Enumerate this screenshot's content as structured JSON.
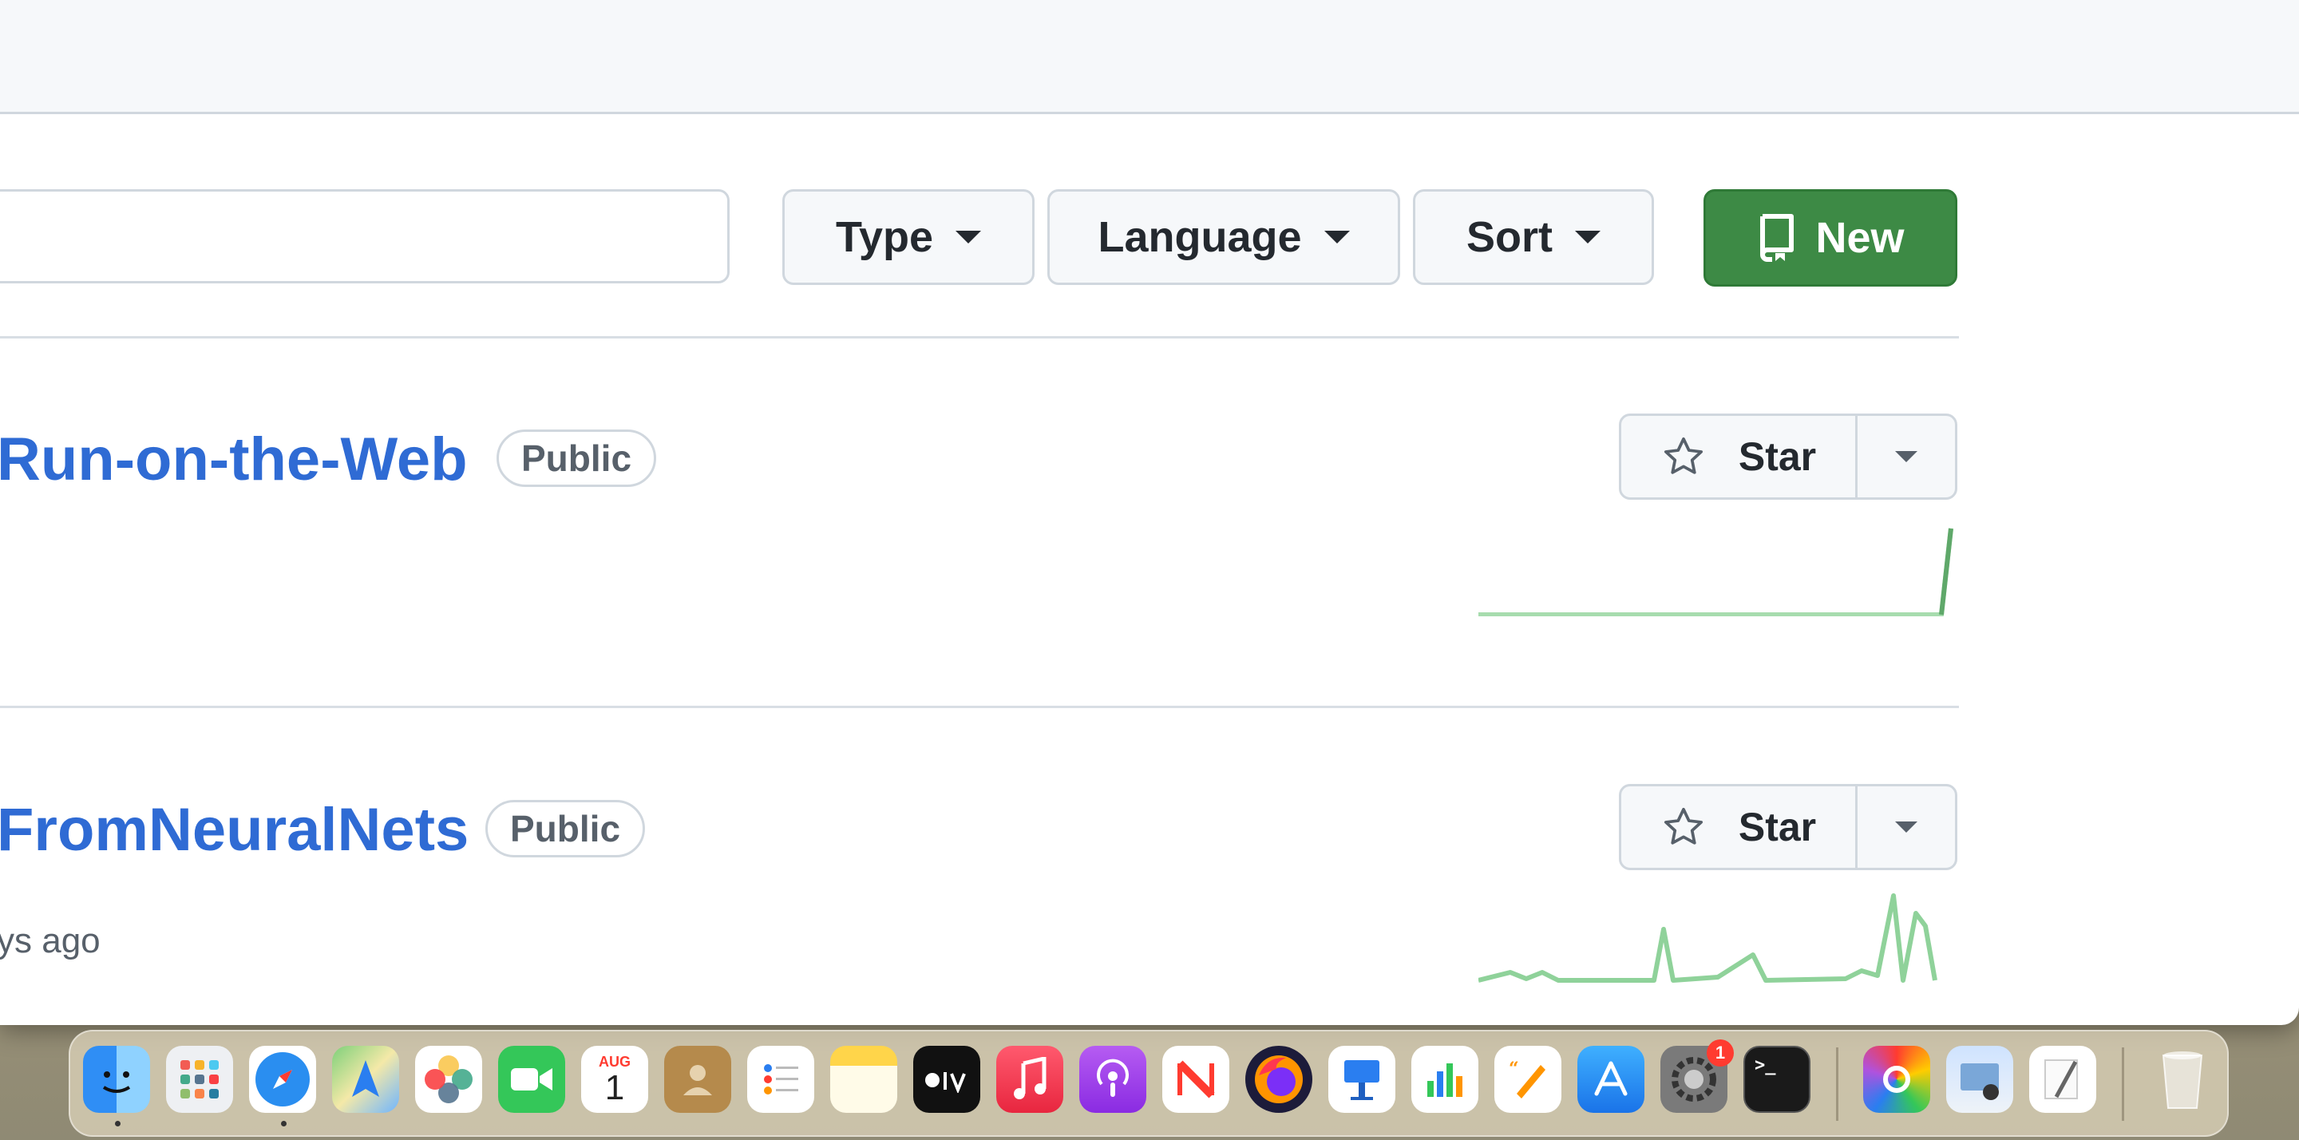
{
  "filters": {
    "type_label": "Type",
    "language_label": "Language",
    "sort_label": "Sort",
    "new_label": "New"
  },
  "repos": [
    {
      "name": "Run-on-the-Web",
      "visibility": "Public",
      "updated": "",
      "star_label": "Star"
    },
    {
      "name": "FromNeuralNets",
      "visibility": "Public",
      "updated": "ys ago",
      "star_label": "Star"
    }
  ],
  "dock": {
    "calendar_month": "AUG",
    "calendar_day": "1",
    "settings_badge": "1",
    "icons": [
      "finder-icon",
      "launchpad-icon",
      "safari-icon",
      "maps-icon",
      "photos-icon",
      "facetime-icon",
      "calendar-icon",
      "contacts-icon",
      "reminders-icon",
      "notes-icon",
      "apple-tv-icon",
      "music-icon",
      "podcasts-icon",
      "news-icon",
      "firefox-icon",
      "keynote-icon",
      "numbers-icon",
      "pages-icon",
      "app-store-icon",
      "system-settings-icon",
      "terminal-icon",
      "colorsync-icon",
      "preview-icon",
      "textedit-icon",
      "trash-icon"
    ]
  },
  "colors": {
    "link": "#2f6bd4",
    "new_button": "#3d8a45",
    "sparkline": "#7cc98a"
  }
}
